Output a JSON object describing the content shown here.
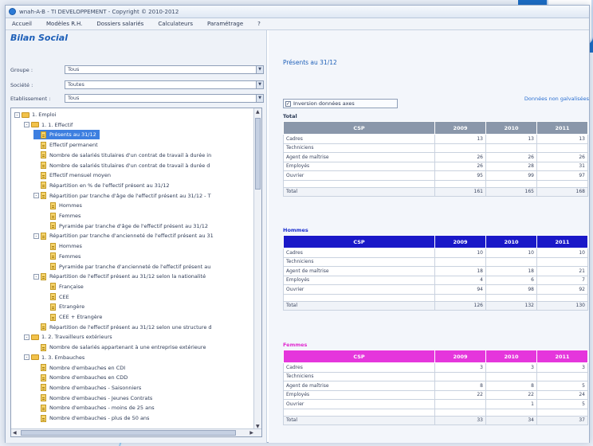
{
  "window": {
    "title": "wnah-A-B - TI DEVELOPPEMENT - Copyright © 2010-2012"
  },
  "menu": [
    "Accueil",
    "Modèles R.H.",
    "Dossiers salariés",
    "Calculateurs",
    "Paramétrage",
    "?"
  ],
  "page_title": "Bilan Social",
  "filters": [
    {
      "label": "Groupe :",
      "value": "Tous"
    },
    {
      "label": "Société :",
      "value": "Toutes"
    },
    {
      "label": "Etablissement :",
      "value": "Tous"
    }
  ],
  "tree": [
    {
      "level": 0,
      "kind": "folder",
      "expander": "-",
      "label": "1. Emploi"
    },
    {
      "level": 1,
      "kind": "folder",
      "expander": "-",
      "label": "1. 1. Effectif"
    },
    {
      "level": 2,
      "kind": "doc",
      "expander": "",
      "label": "Présents au 31/12",
      "selected": true
    },
    {
      "level": 2,
      "kind": "doc",
      "expander": "",
      "label": "Effectif permanent"
    },
    {
      "level": 2,
      "kind": "doc",
      "expander": "",
      "label": "Nombre de salariés titulaires d'un contrat de travail à durée in"
    },
    {
      "level": 2,
      "kind": "doc",
      "expander": "",
      "label": "Nombre de salariés titulaires d'un contrat de travail à durée d"
    },
    {
      "level": 2,
      "kind": "doc",
      "expander": "",
      "label": "Effectif mensuel moyen"
    },
    {
      "level": 2,
      "kind": "doc",
      "expander": "",
      "label": "Répartition en % de l'effectif présent au 31/12"
    },
    {
      "level": 2,
      "kind": "doc",
      "expander": "-",
      "label": "Répartition par tranche d'âge de l'effectif présent au 31/12 - T"
    },
    {
      "level": 3,
      "kind": "doc",
      "expander": "",
      "label": "Hommes"
    },
    {
      "level": 3,
      "kind": "doc",
      "expander": "",
      "label": "Femmes"
    },
    {
      "level": 3,
      "kind": "doc",
      "expander": "",
      "label": "Pyramide par tranche d'âge de l'effectif présent au 31/12"
    },
    {
      "level": 2,
      "kind": "doc",
      "expander": "-",
      "label": "Répartition par tranche d'ancienneté de l'effectif présent au 31"
    },
    {
      "level": 3,
      "kind": "doc",
      "expander": "",
      "label": "Hommes"
    },
    {
      "level": 3,
      "kind": "doc",
      "expander": "",
      "label": "Femmes"
    },
    {
      "level": 3,
      "kind": "doc",
      "expander": "",
      "label": "Pyramide par tranche d'ancienneté de l'effectif présent au"
    },
    {
      "level": 2,
      "kind": "doc",
      "expander": "-",
      "label": "Répartition de l'effectif présent au 31/12 selon la nationalité"
    },
    {
      "level": 3,
      "kind": "doc",
      "expander": "",
      "label": "Française"
    },
    {
      "level": 3,
      "kind": "doc",
      "expander": "",
      "label": "CEE"
    },
    {
      "level": 3,
      "kind": "doc",
      "expander": "",
      "label": "Etrangère"
    },
    {
      "level": 3,
      "kind": "doc",
      "expander": "",
      "label": "CEE + Etrangère"
    },
    {
      "level": 2,
      "kind": "doc",
      "expander": "",
      "label": "Répartition de l'effectif présent au 31/12 selon une structure d"
    },
    {
      "level": 1,
      "kind": "folder",
      "expander": "-",
      "label": "1. 2. Travailleurs extérieurs"
    },
    {
      "level": 2,
      "kind": "doc",
      "expander": "",
      "label": "Nombre de salariés appartenant à une entreprise extérieure"
    },
    {
      "level": 1,
      "kind": "folder",
      "expander": "-",
      "label": "1. 3. Embauches"
    },
    {
      "level": 2,
      "kind": "doc",
      "expander": "",
      "label": "Nombre d'embauches en CDI"
    },
    {
      "level": 2,
      "kind": "doc",
      "expander": "",
      "label": "Nombre d'embauches en CDD"
    },
    {
      "level": 2,
      "kind": "doc",
      "expander": "",
      "label": "Nombre d'embauches - Saisonniers"
    },
    {
      "level": 2,
      "kind": "doc",
      "expander": "",
      "label": "Nombre d'embauches - Jeunes Contrats"
    },
    {
      "level": 2,
      "kind": "doc",
      "expander": "",
      "label": "Nombre d'embauches - moins de 25 ans"
    },
    {
      "level": 2,
      "kind": "doc",
      "expander": "",
      "label": "Nombre d'embauches - plus de 50 ans"
    }
  ],
  "right": {
    "heading": "Présents au 31/12",
    "checkbox_label": "Inversion données axes",
    "graph_link": "Données non galvalisées",
    "tables": [
      {
        "title": "Total",
        "title_color": "#2b3a55",
        "header_color": "#8a97aa",
        "columns": [
          "CSP",
          "2009",
          "2010",
          "2011"
        ],
        "rows": [
          {
            "label": "Cadres",
            "values": [
              "13",
              "13",
              "13"
            ]
          },
          {
            "label": "Techniciens",
            "values": [
              "",
              "",
              ""
            ]
          },
          {
            "label": "Agent de maîtrise",
            "values": [
              "26",
              "26",
              "26"
            ]
          },
          {
            "label": "Employés",
            "values": [
              "26",
              "28",
              "31"
            ]
          },
          {
            "label": "Ouvrier",
            "values": [
              "95",
              "99",
              "97"
            ]
          }
        ],
        "total": {
          "label": "Total",
          "values": [
            "161",
            "165",
            "168"
          ]
        }
      },
      {
        "title": "Hommes",
        "title_color": "#1a2fd0",
        "header_color": "#1a18c8",
        "columns": [
          "CSP",
          "2009",
          "2010",
          "2011"
        ],
        "rows": [
          {
            "label": "Cadres",
            "values": [
              "10",
              "10",
              "10"
            ]
          },
          {
            "label": "Techniciens",
            "values": [
              "",
              "",
              ""
            ]
          },
          {
            "label": "Agent de maîtrise",
            "values": [
              "18",
              "18",
              "21"
            ]
          },
          {
            "label": "Employés",
            "values": [
              "4",
              "6",
              "7"
            ]
          },
          {
            "label": "Ouvrier",
            "values": [
              "94",
              "98",
              "92"
            ]
          }
        ],
        "total": {
          "label": "Total",
          "values": [
            "126",
            "132",
            "130"
          ]
        }
      },
      {
        "title": "Femmes",
        "title_color": "#e02bd0",
        "header_color": "#e536dc",
        "columns": [
          "CSP",
          "2009",
          "2010",
          "2011"
        ],
        "rows": [
          {
            "label": "Cadres",
            "values": [
              "3",
              "3",
              "3"
            ]
          },
          {
            "label": "Techniciens",
            "values": [
              "",
              "",
              ""
            ]
          },
          {
            "label": "Agent de maîtrise",
            "values": [
              "8",
              "8",
              "5"
            ]
          },
          {
            "label": "Employés",
            "values": [
              "22",
              "22",
              "24"
            ]
          },
          {
            "label": "Ouvrier",
            "values": [
              "",
              "1",
              "5"
            ]
          }
        ],
        "total": {
          "label": "Total",
          "values": [
            "33",
            "34",
            "37"
          ]
        }
      }
    ]
  }
}
